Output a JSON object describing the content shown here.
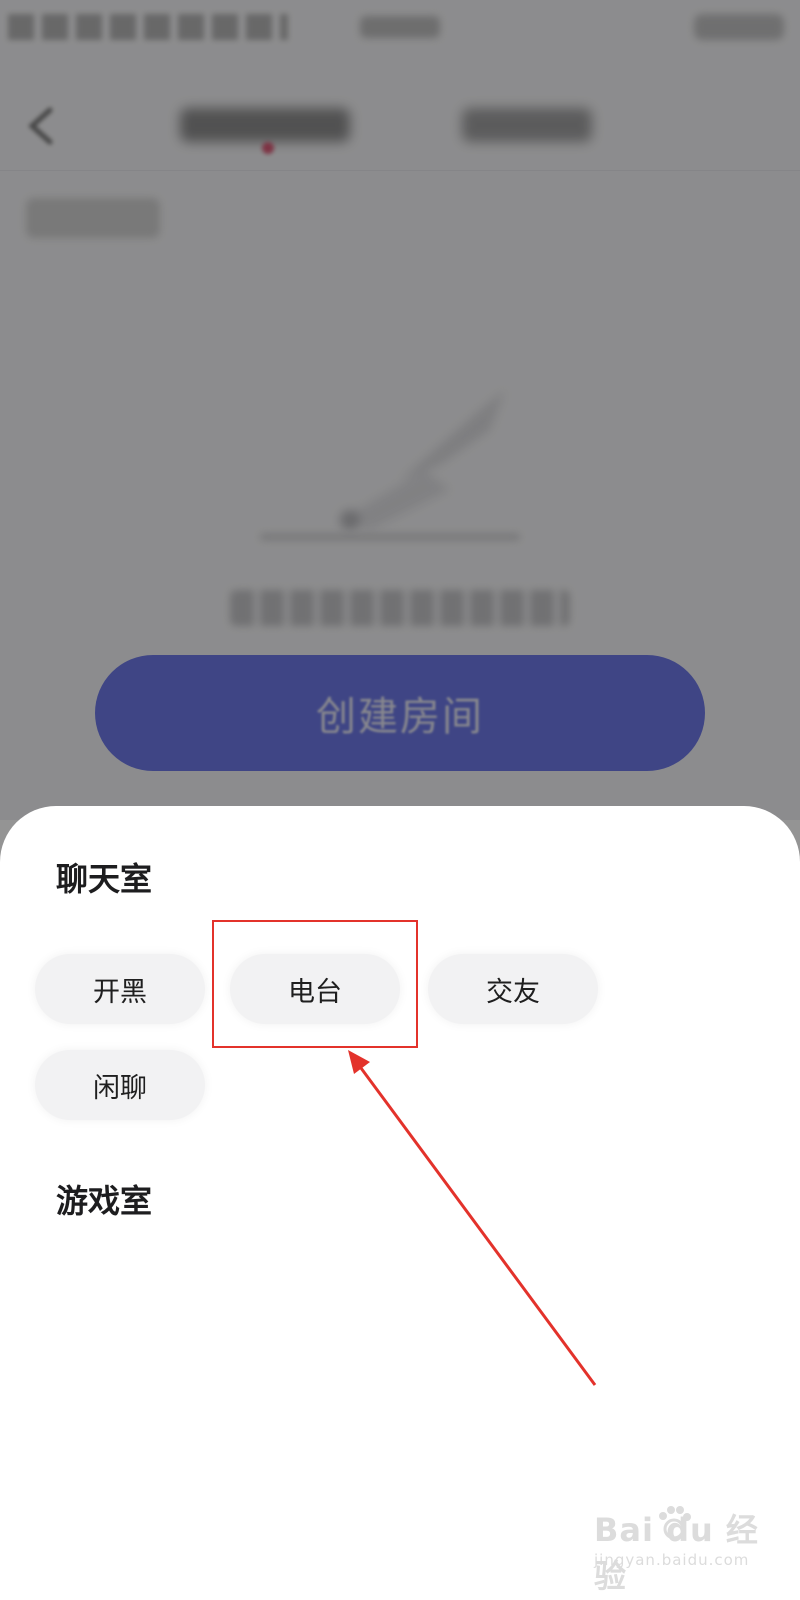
{
  "background": {
    "create_button_label": "创建房间"
  },
  "sheet": {
    "chat_section_title": "聊天室",
    "chat_options": [
      {
        "label": "开黑"
      },
      {
        "label": "电台"
      },
      {
        "label": "交友"
      },
      {
        "label": "闲聊"
      }
    ],
    "game_section_title": "游戏室"
  },
  "annotation": {
    "highlight_color": "#e3322b",
    "highlighted_option": "电台"
  },
  "watermark": {
    "brand": "Bai du 经验",
    "url": "jingyan.baidu.com"
  },
  "colors": {
    "accent": "#6d78e6",
    "dim_overlay": "rgba(0,0,0,0.42)",
    "chip_bg": "#f2f2f3"
  }
}
